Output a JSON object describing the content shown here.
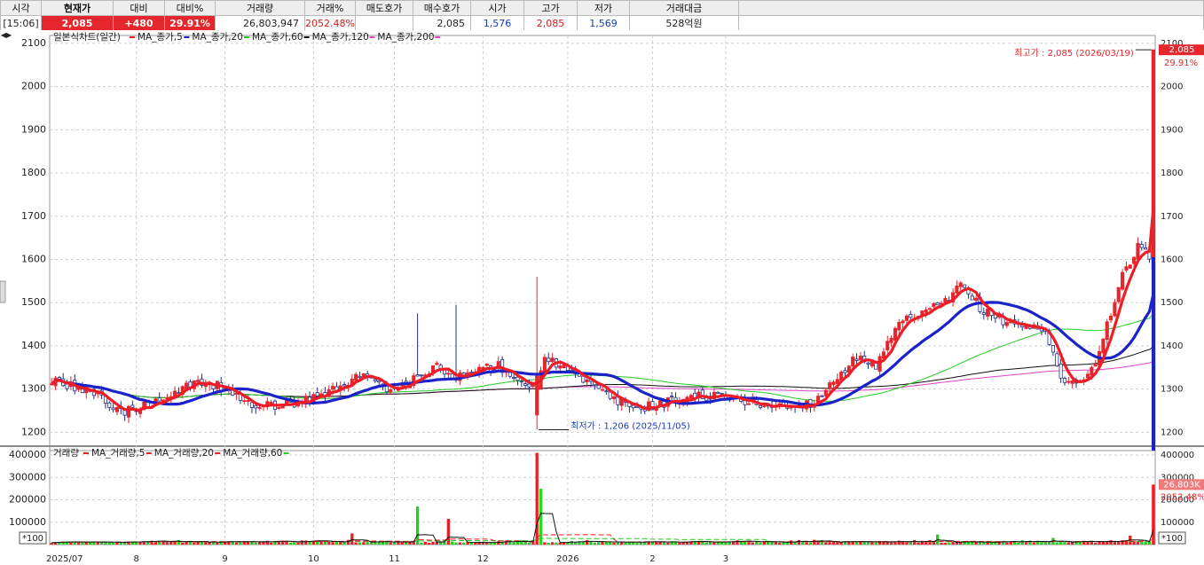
{
  "header": {
    "cols": [
      "시각",
      "현재가",
      "대비",
      "대비%",
      "거래량",
      "거래%",
      "매도호가",
      "매수호가",
      "시가",
      "고가",
      "저가",
      "거래대금"
    ],
    "values": [
      "[15:06]",
      "2,085",
      "+480",
      "29.91%",
      "26,803,947",
      "2052.48%",
      "",
      "2,085",
      "1,576",
      "2,085",
      "1,569",
      "528억원"
    ]
  },
  "colors": {
    "up": "#e5262c",
    "down": "#1a3bb5",
    "ma5": "#ee1c24",
    "ma20": "#1a22c8",
    "ma60": "#22cc22",
    "ma120": "#111111",
    "ma200": "#dd44cc",
    "vol": "#ee1c24",
    "volma5": "#111111",
    "volma20": "#ee1c24",
    "volma60": "#22cc22"
  },
  "chart_data": [
    {
      "type": "candlestick",
      "title": "일본식차트(일간)",
      "legend": [
        {
          "name": "MA_종가,5",
          "color": "#ee1c24"
        },
        {
          "name": "MA_종가,20",
          "color": "#1a22c8"
        },
        {
          "name": "MA_종가,60",
          "color": "#22cc22"
        },
        {
          "name": "MA_종가,120",
          "color": "#111111"
        },
        {
          "name": "MA_종가,200",
          "color": "#dd44cc"
        }
      ],
      "x_ticks": [
        "2025/07",
        "8",
        "9",
        "10",
        "11",
        "12",
        "2026",
        "2",
        "3"
      ],
      "y_ticks": [
        1200,
        1300,
        1400,
        1500,
        1600,
        1700,
        1800,
        1900,
        2000,
        2100
      ],
      "ylim": [
        1170,
        2110
      ],
      "annotations": {
        "high": "최고가 : 2,085 (2026/03/19)",
        "low": "최저가 : 1,206 (2025/11/05)",
        "last_price": "2,085",
        "last_change": "29.91%"
      },
      "series": [
        {
          "name": "MA_종가,5",
          "color": "#ee1c24"
        },
        {
          "name": "MA_종가,20",
          "color": "#1a22c8"
        },
        {
          "name": "MA_종가,60",
          "color": "#22cc22"
        },
        {
          "name": "MA_종가,120",
          "color": "#111111"
        },
        {
          "name": "MA_종가,200",
          "color": "#dd44cc"
        }
      ],
      "keypoints": [
        {
          "d": 0,
          "c": 1320
        },
        {
          "d": 10,
          "c": 1295
        },
        {
          "d": 18,
          "c": 1245
        },
        {
          "d": 24,
          "c": 1265
        },
        {
          "d": 30,
          "c": 1280
        },
        {
          "d": 38,
          "c": 1320
        },
        {
          "d": 44,
          "c": 1305
        },
        {
          "d": 52,
          "c": 1265
        },
        {
          "d": 58,
          "c": 1262
        },
        {
          "d": 64,
          "c": 1270
        },
        {
          "d": 72,
          "c": 1295
        },
        {
          "d": 80,
          "c": 1330
        },
        {
          "d": 88,
          "c": 1300
        },
        {
          "d": 96,
          "c": 1330
        },
        {
          "d": 100,
          "c": 1360
        },
        {
          "d": 104,
          "c": 1320
        },
        {
          "d": 110,
          "c": 1345
        },
        {
          "d": 116,
          "c": 1355
        },
        {
          "d": 122,
          "c": 1320
        },
        {
          "d": 126,
          "c": 1300
        },
        {
          "d": 128,
          "c": 1380
        },
        {
          "d": 134,
          "c": 1340
        },
        {
          "d": 140,
          "c": 1310
        },
        {
          "d": 146,
          "c": 1275
        },
        {
          "d": 152,
          "c": 1255
        },
        {
          "d": 160,
          "c": 1270
        },
        {
          "d": 168,
          "c": 1285
        },
        {
          "d": 176,
          "c": 1280
        },
        {
          "d": 184,
          "c": 1265
        },
        {
          "d": 192,
          "c": 1258
        },
        {
          "d": 198,
          "c": 1270
        },
        {
          "d": 204,
          "c": 1330
        },
        {
          "d": 210,
          "c": 1380
        },
        {
          "d": 214,
          "c": 1350
        },
        {
          "d": 220,
          "c": 1450
        },
        {
          "d": 226,
          "c": 1475
        },
        {
          "d": 232,
          "c": 1500
        },
        {
          "d": 236,
          "c": 1540
        },
        {
          "d": 242,
          "c": 1480
        },
        {
          "d": 248,
          "c": 1455
        },
        {
          "d": 254,
          "c": 1445
        },
        {
          "d": 258,
          "c": 1430
        },
        {
          "d": 262,
          "c": 1330
        },
        {
          "d": 266,
          "c": 1310
        },
        {
          "d": 270,
          "c": 1340
        },
        {
          "d": 274,
          "c": 1450
        },
        {
          "d": 278,
          "c": 1560
        },
        {
          "d": 282,
          "c": 1630
        },
        {
          "d": 285,
          "c": 1605
        },
        {
          "d": 286,
          "c": 2085
        }
      ],
      "volume_keypoints": [
        {
          "d": 0,
          "v": 8000
        },
        {
          "d": 40,
          "v": 10000
        },
        {
          "d": 78,
          "v": 50000
        },
        {
          "d": 95,
          "v": 170000
        },
        {
          "d": 103,
          "v": 115000
        },
        {
          "d": 126,
          "v": 410000
        },
        {
          "d": 127,
          "v": 250000
        },
        {
          "d": 140,
          "v": 15000
        },
        {
          "d": 200,
          "v": 20000
        },
        {
          "d": 230,
          "v": 45000
        },
        {
          "d": 260,
          "v": 30000
        },
        {
          "d": 280,
          "v": 40000
        },
        {
          "d": 286,
          "v": 268039
        }
      ]
    },
    {
      "type": "bar",
      "title": "거래량",
      "legend": [
        {
          "name": "MA_거래량,5",
          "color": "#111111"
        },
        {
          "name": "MA_거래량,20",
          "color": "#ee1c24"
        },
        {
          "name": "MA_거래량,60",
          "color": "#22cc22"
        }
      ],
      "y_ticks": [
        100000,
        200000,
        300000,
        400000
      ],
      "ylim": [
        0,
        420000
      ],
      "unit_label": "*100",
      "last_volume": "26,803K",
      "last_ratio": "2052.48%"
    }
  ]
}
